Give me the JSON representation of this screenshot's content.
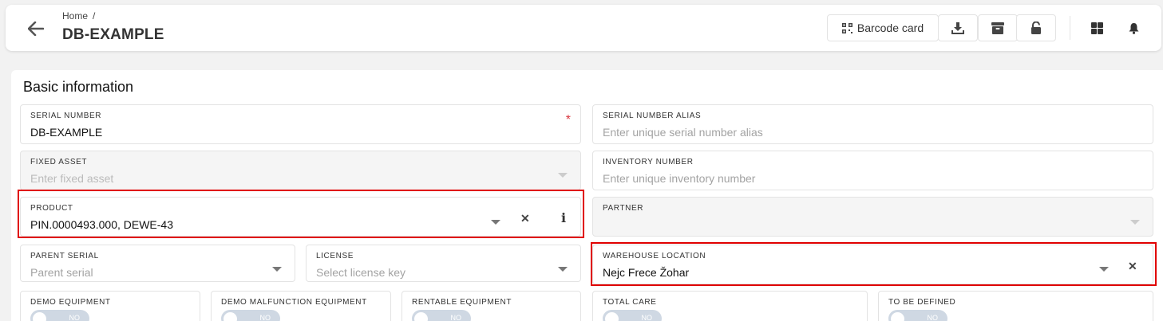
{
  "header": {
    "breadcrumb_home": "Home",
    "breadcrumb_sep": "/",
    "title": "DB-EXAMPLE",
    "barcode_label": "Barcode card"
  },
  "section": {
    "title": "Basic information"
  },
  "fields": {
    "serial_number": {
      "label": "SERIAL NUMBER",
      "value": "DB-EXAMPLE",
      "required_mark": "*"
    },
    "serial_alias": {
      "label": "SERIAL NUMBER ALIAS",
      "placeholder": "Enter unique serial number alias"
    },
    "fixed_asset": {
      "label": "FIXED ASSET",
      "placeholder": "Enter fixed asset"
    },
    "inventory_number": {
      "label": "INVENTORY NUMBER",
      "placeholder": "Enter unique inventory number"
    },
    "product": {
      "label": "PRODUCT",
      "value": "PIN.0000493.000, DEWE-43"
    },
    "partner": {
      "label": "PARTNER"
    },
    "parent_serial": {
      "label": "PARENT SERIAL",
      "placeholder": "Parent serial"
    },
    "license": {
      "label": "LICENSE",
      "placeholder": "Select license key"
    },
    "warehouse_location": {
      "label": "WAREHOUSE LOCATION",
      "value": "Nejc Frece Žohar"
    }
  },
  "toggles": {
    "demo_equipment": {
      "label": "DEMO EQUIPMENT",
      "state": "NO"
    },
    "demo_malfunction": {
      "label": "DEMO MALFUNCTION EQUIPMENT",
      "state": "NO"
    },
    "rentable_equipment": {
      "label": "RENTABLE EQUIPMENT",
      "state": "NO"
    },
    "total_care": {
      "label": "TOTAL CARE",
      "state": "NO"
    },
    "to_be_defined": {
      "label": "TO BE DEFINED",
      "state": "NO"
    }
  },
  "colors": {
    "highlight": "#e00000",
    "required": "#d9363e",
    "toggle_off": "#cfd8e3"
  },
  "icons": [
    "arrow-left-icon",
    "qr-icon",
    "download-icon",
    "archive-icon",
    "unlock-icon",
    "grid-icon",
    "bell-icon",
    "close-icon",
    "info-icon",
    "chevron-down-icon"
  ]
}
